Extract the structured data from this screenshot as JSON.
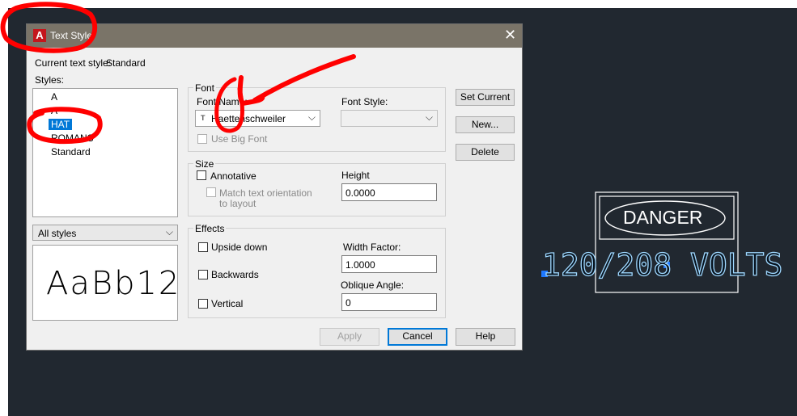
{
  "dialog": {
    "title": "Text Style",
    "current_style_label": "Current text style:",
    "current_style_value": "Standard",
    "styles_label": "Styles:",
    "styles": [
      "A",
      "A",
      "HAT",
      "ROMANS",
      "Standard"
    ],
    "selected_style": "HAT",
    "filter_value": "All styles",
    "preview_text": "AaBb12",
    "font": {
      "group_label": "Font",
      "font_name_label": "Font Name:",
      "font_name_value": "Haettenschweiler",
      "font_style_label": "Font Style:",
      "font_style_value": "",
      "big_font_label": "Use Big Font"
    },
    "size": {
      "group_label": "Size",
      "annotative_label": "Annotative",
      "match_orientation_label_1": "Match text orientation",
      "match_orientation_label_2": "to layout",
      "height_label": "Height",
      "height_value": "0.0000"
    },
    "effects": {
      "group_label": "Effects",
      "upside_down_label": "Upside down",
      "backwards_label": "Backwards",
      "vertical_label": "Vertical",
      "width_factor_label": "Width Factor:",
      "width_factor_value": "1.0000",
      "oblique_angle_label": "Oblique Angle:",
      "oblique_angle_value": "0"
    },
    "buttons": {
      "set_current": "Set Current",
      "new": "New...",
      "delete": "Delete",
      "apply": "Apply",
      "cancel": "Cancel",
      "help": "Help"
    }
  },
  "drawing": {
    "sign_label": "DANGER",
    "voltage_text": "120/208 VOLTS"
  },
  "colors": {
    "canvas_bg": "#212830",
    "cad_text": "#9fd8ff",
    "grip": "#1e78ff",
    "annotation": "#ff0000",
    "selection": "#0078d7"
  }
}
